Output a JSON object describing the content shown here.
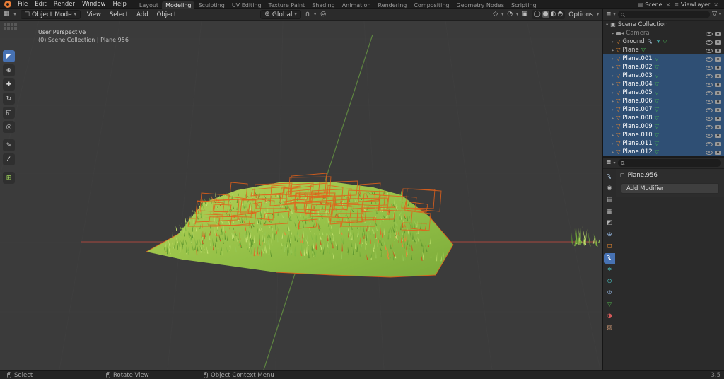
{
  "topbar": {
    "menus": [
      "File",
      "Edit",
      "Render",
      "Window",
      "Help"
    ],
    "workspaces": [
      "Layout",
      "Modeling",
      "Sculpting",
      "UV Editing",
      "Texture Paint",
      "Shading",
      "Animation",
      "Rendering",
      "Compositing",
      "Geometry Nodes",
      "Scripting"
    ],
    "active_workspace": "Modeling",
    "scene": "Scene",
    "view_layer": "ViewLayer"
  },
  "viewport": {
    "header": {
      "mode": "Object Mode",
      "menus": [
        "View",
        "Select",
        "Add",
        "Object"
      ],
      "orientation": "Global",
      "options": "Options"
    },
    "overlay": {
      "line1": "User Perspective",
      "line2": "(0) Scene Collection | Plane.956"
    }
  },
  "outliner": {
    "root": "Scene Collection",
    "items": [
      {
        "name": "Camera",
        "icon": "camera",
        "selected": false,
        "dim": true
      },
      {
        "name": "Ground",
        "icon": "mesh",
        "selected": false,
        "extras": [
          "modifier",
          "particles"
        ]
      },
      {
        "name": "Plane",
        "icon": "mesh",
        "selected": false
      },
      {
        "name": "Plane.001",
        "icon": "mesh",
        "selected": true
      },
      {
        "name": "Plane.002",
        "icon": "mesh",
        "selected": true
      },
      {
        "name": "Plane.003",
        "icon": "mesh",
        "selected": true
      },
      {
        "name": "Plane.004",
        "icon": "mesh",
        "selected": true
      },
      {
        "name": "Plane.005",
        "icon": "mesh",
        "selected": true
      },
      {
        "name": "Plane.006",
        "icon": "mesh",
        "selected": true
      },
      {
        "name": "Plane.007",
        "icon": "mesh",
        "selected": true
      },
      {
        "name": "Plane.008",
        "icon": "mesh",
        "selected": true
      },
      {
        "name": "Plane.009",
        "icon": "mesh",
        "selected": true
      },
      {
        "name": "Plane.010",
        "icon": "mesh",
        "selected": true
      },
      {
        "name": "Plane.011",
        "icon": "mesh",
        "selected": true
      },
      {
        "name": "Plane.012",
        "icon": "mesh",
        "selected": true
      }
    ]
  },
  "properties": {
    "breadcrumb": "Plane.956",
    "add_modifier": "Add Modifier",
    "tabs": [
      "tool",
      "render",
      "output",
      "view-layer",
      "scene",
      "world",
      "object",
      "modifiers",
      "particles",
      "physics",
      "constraints",
      "object-data",
      "material",
      "texture"
    ],
    "active_tab": "modifiers"
  },
  "statusbar": {
    "items": [
      "Select",
      "Rotate View",
      "Object Context Menu"
    ],
    "version": "3.5"
  },
  "colors": {
    "accent_blue": "#4772b3",
    "mesh_orange": "#e8882f",
    "data_green": "#46b051",
    "wire_orange": "#e2611a",
    "selection_row": "#2f4f74"
  },
  "icons": {
    "disclosure": "▸",
    "disclosure_open": "▾",
    "dropdown": "▾",
    "close": "×",
    "mesh": "▽",
    "particles": "∗",
    "collection": "▣",
    "editor_viewport": "▦",
    "editor_outliner": "≡",
    "editor_properties": "≣",
    "mode_object": "◻",
    "global": "⊕",
    "magnet": "∩",
    "proportional": "◎",
    "gizmo": "◇",
    "overlays": "◔",
    "xray": "▣",
    "shade_wire": "◯",
    "shade_solid": "●",
    "shade_material": "◐",
    "shade_render": "◓",
    "scene_browse": "▤",
    "viewlayer": "≣",
    "funnel": "▽",
    "tool_select": "◤",
    "tool_cursor": "⊕",
    "tool_move": "✚",
    "tool_rotate": "↻",
    "tool_scale": "◱",
    "tool_transform": "◎",
    "tool_annotate": "✎",
    "tool_measure": "∠",
    "tool_addcube": "⊞",
    "tab_render": "◉",
    "tab_output": "▤",
    "tab_viewlayer": "▦",
    "tab_scene": "◩",
    "tab_world": "⊕",
    "tab_object": "◻",
    "tab_particles": "∗",
    "tab_physics": "⊙",
    "tab_constraints": "⊘",
    "tab_data": "▽",
    "tab_material": "◑",
    "tab_texture": "▨"
  }
}
